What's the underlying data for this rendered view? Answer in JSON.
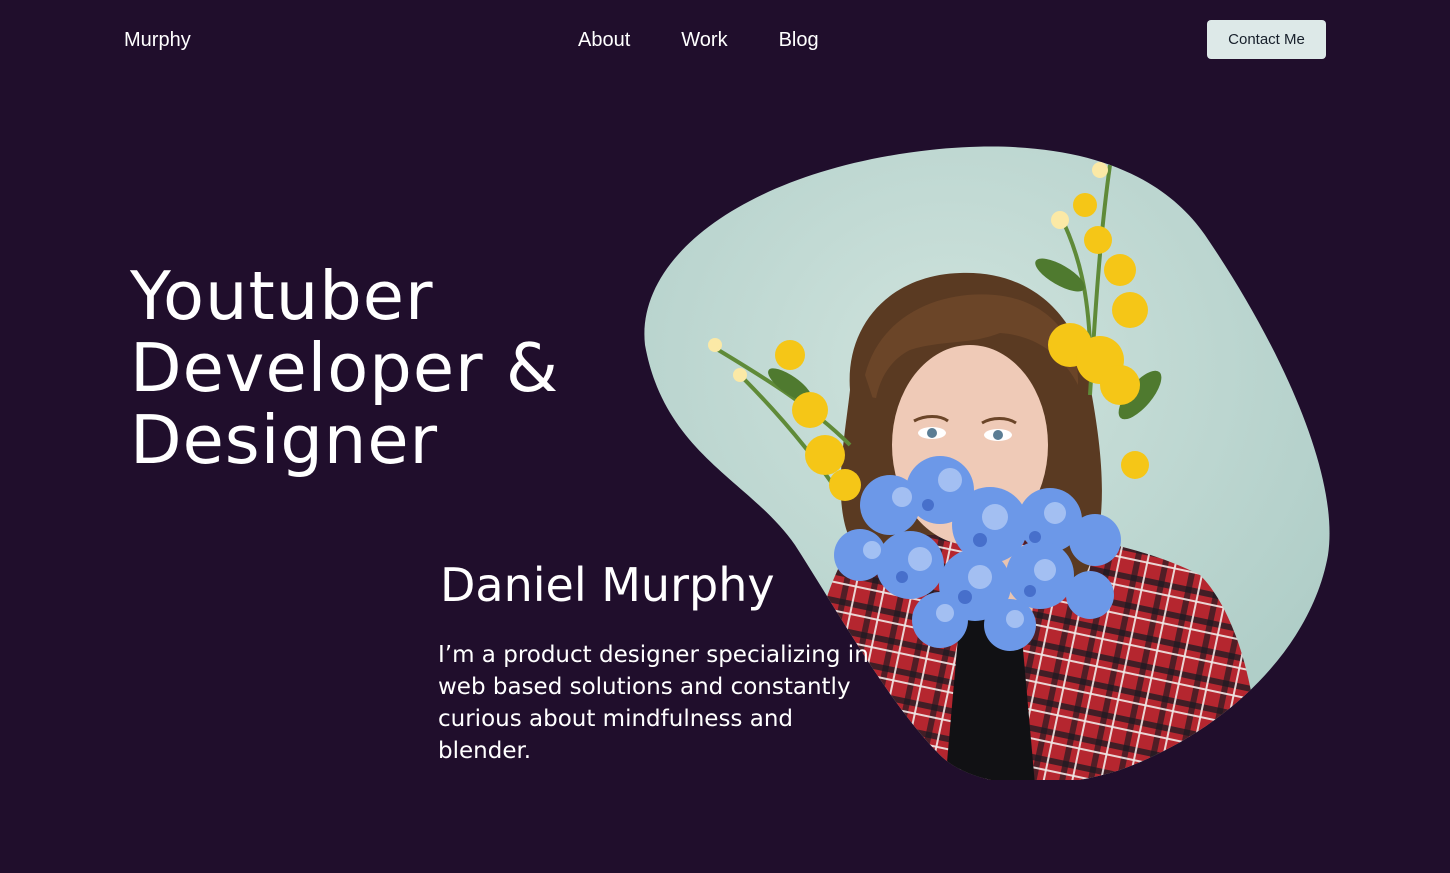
{
  "nav": {
    "logo": "Murphy",
    "links": [
      "About",
      "Work",
      "Blog"
    ],
    "contact_label": "Contact Me"
  },
  "hero": {
    "title_lines": [
      "Youtuber",
      "Developer &",
      "Designer"
    ],
    "name": "Daniel Murphy",
    "bio": "I’m a product designer specializing in web based solutions and constantly curious about mindfulness and blender."
  },
  "colors": {
    "background": "#200e2c",
    "text": "#ffffff",
    "button_bg": "#dde9e8",
    "button_text": "#17202b",
    "photo_backdrop": "#b8d4cf",
    "flower_yellow": "#f5c617",
    "flower_blue": "#6c98e8",
    "shirt_red": "#b5262f"
  },
  "icons": {
    "portrait": "portrait-photo"
  }
}
